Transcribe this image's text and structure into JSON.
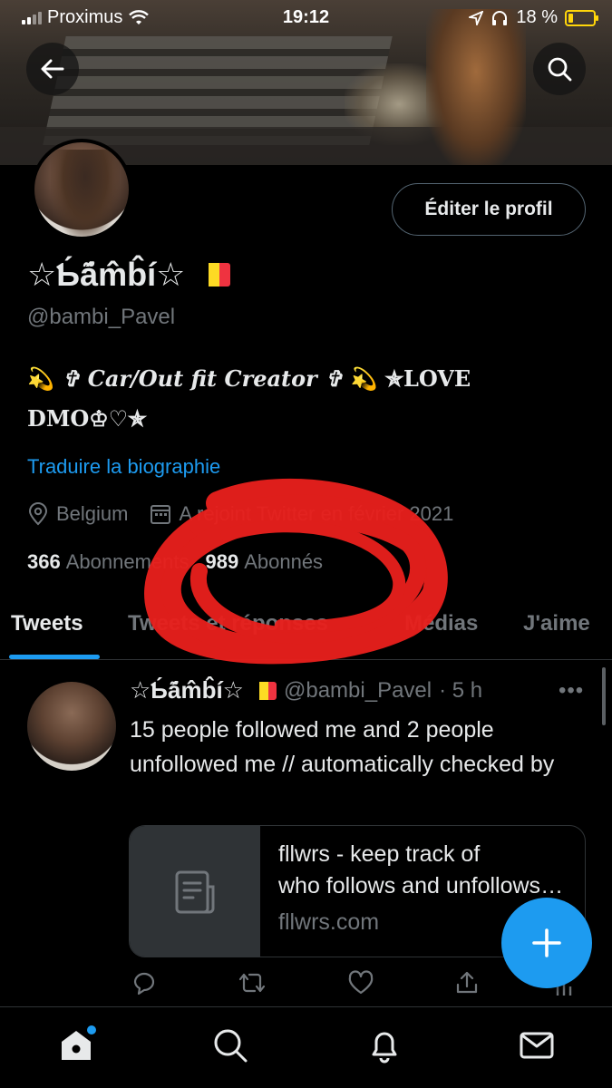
{
  "status_bar": {
    "carrier": "Proximus",
    "time": "19:12",
    "battery": "18 %",
    "battery_level": 0.18
  },
  "profile": {
    "display_name": "☆Ɓ̸̛̍ä̶m̸̛b̴̛͝i̶☆",
    "display_name_plain": "☆Ƅ́á͂m̂b̂í☆",
    "flag_colors": [
      "#000000",
      "#FDDA24",
      "#EF3340"
    ],
    "handle": "@bambi_Pavel",
    "edit_button": "Éditer le profil",
    "bio_line1_emoji": "💫",
    "bio_line1": "✞ Car/Out fit Creator ✞",
    "bio_line1_emoji2": "💫",
    "bio_line1_tail": "✯LOVE",
    "bio_line2": "DMO♔♡✯",
    "translate_link": "Traduire la biographie",
    "location": "Belgium",
    "joined": "A rejoint Twitter en février 2021",
    "following_count": "366",
    "following_label": "Abonnements",
    "followers_count": "989",
    "followers_label": "Abonnés"
  },
  "tabs": [
    {
      "label": "Tweets",
      "active": true
    },
    {
      "label": "Tweets et réponses",
      "active": false
    },
    {
      "label": "Médias",
      "active": false
    },
    {
      "label": "J'aime",
      "active": false
    }
  ],
  "tweet": {
    "display_name": "☆Ƅ́á͂m̂b̂í☆",
    "handle": "@bambi_Pavel",
    "time": "· 5 h",
    "more": "•••",
    "text": "15 people followed me and 2 people unfollowed me // automatically checked by",
    "card": {
      "title_line1": "fllwrs - keep track of",
      "title_line2": "who follows and unfollows you",
      "domain": "fllwrs.com"
    }
  },
  "icons": {
    "back": "back-arrow-icon",
    "search": "search-icon",
    "location": "location-pin-icon",
    "calendar": "calendar-icon",
    "reply": "reply-icon",
    "retweet": "retweet-icon",
    "like": "heart-icon",
    "share": "share-icon",
    "compose": "plus-icon",
    "home": "home-icon",
    "explore": "search-icon",
    "notifications": "bell-icon",
    "messages": "mail-icon"
  },
  "colors": {
    "accent": "#1d9bf0",
    "muted": "#71767b",
    "annotation": "#e8201d"
  }
}
